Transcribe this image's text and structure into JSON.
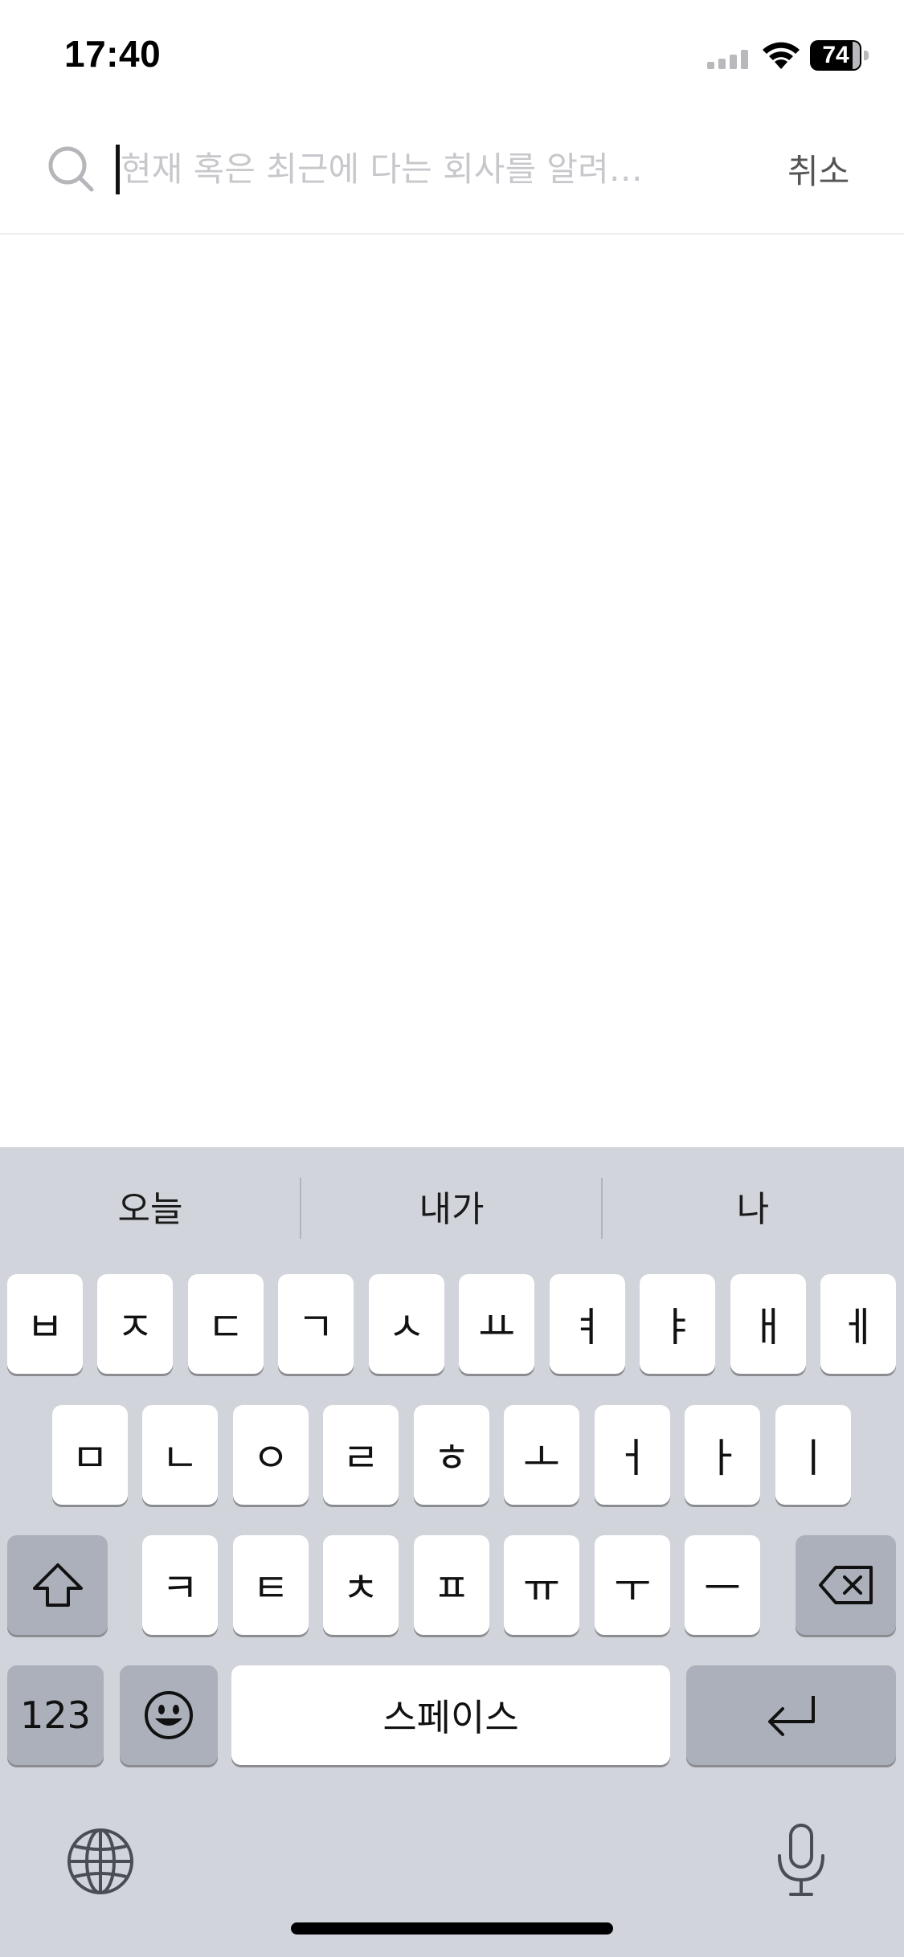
{
  "status_bar": {
    "time": "17:40",
    "battery": "74",
    "icons": [
      "signal-icon",
      "wifi-icon",
      "battery-icon"
    ]
  },
  "search": {
    "placeholder": "현재 혹은 최근에 다는 회사를 알려…",
    "value": "",
    "cancel_label": "취소",
    "icon": "search-icon"
  },
  "keyboard": {
    "suggestions": [
      "오늘",
      "내가",
      "나"
    ],
    "row1": [
      "ㅂ",
      "ㅈ",
      "ㄷ",
      "ㄱ",
      "ㅅ",
      "ㅛ",
      "ㅕ",
      "ㅑ",
      "ㅐ",
      "ㅔ"
    ],
    "row2": [
      "ㅁ",
      "ㄴ",
      "ㅇ",
      "ㄹ",
      "ㅎ",
      "ㅗ",
      "ㅓ",
      "ㅏ",
      "ㅣ"
    ],
    "row3": [
      "ㅋ",
      "ㅌ",
      "ㅊ",
      "ㅍ",
      "ㅠ",
      "ㅜ",
      "ㅡ"
    ],
    "numbers_label": "123",
    "space_label": "스페이스",
    "icons": [
      "shift-icon",
      "backspace-icon",
      "emoji-icon",
      "return-icon",
      "globe-icon",
      "microphone-icon"
    ]
  },
  "colors": {
    "keyboard_bg": "#d1d4db",
    "key_bg": "#ffffff",
    "special_key_bg": "#abb0ba",
    "placeholder": "#c7c7cc"
  }
}
